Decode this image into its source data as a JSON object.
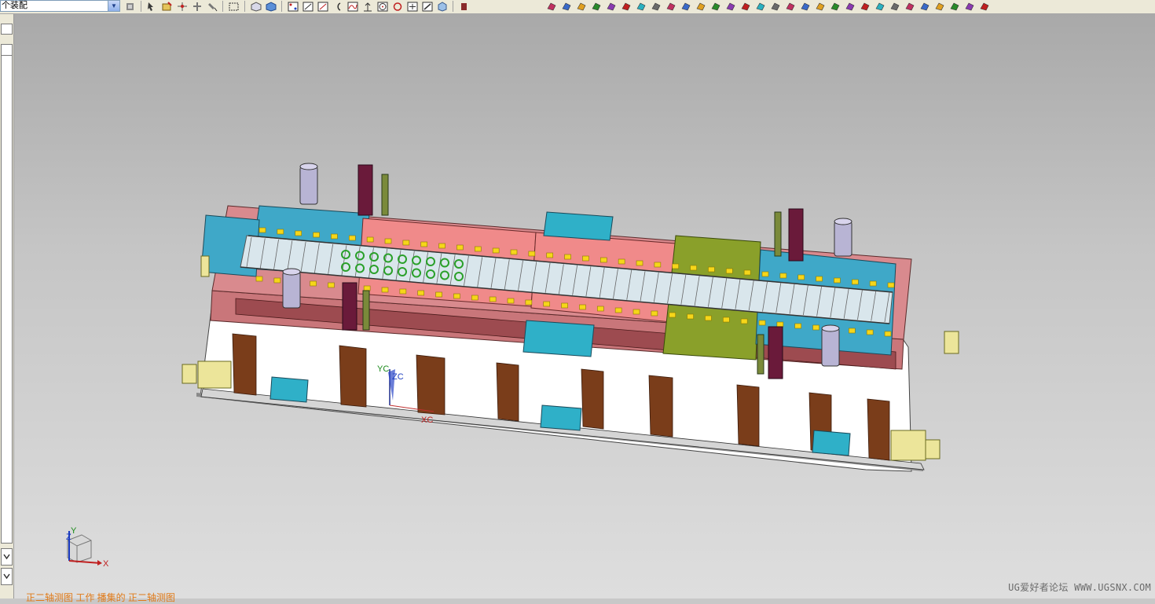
{
  "toolbar": {
    "filter_value": "个装配",
    "icons": [
      "assembly-icon",
      "select-icon",
      "snap-icon",
      "point-icon",
      "move-icon",
      "box-select-icon",
      "view-icon",
      "shade-icon",
      "snap-endpoint-icon",
      "line-icon",
      "arrow-icon",
      "arc-icon",
      "curve-icon",
      "perpendicular-icon",
      "circle-center-icon",
      "circle-icon",
      "plus-icon",
      "diagonal-icon",
      "cube-icon",
      "mold-icon"
    ]
  },
  "viewport": {
    "csys_labels": {
      "yc": "YC",
      "zc": "ZC",
      "xc": "XC"
    },
    "triad_labels": {
      "x": "X",
      "y": "Y",
      "z": "Z"
    }
  },
  "status": {
    "left_text": "正二轴测图 工作 播集的 正二轴测图"
  },
  "watermark": "UG爱好者论坛 WWW.UGSNX.COM"
}
